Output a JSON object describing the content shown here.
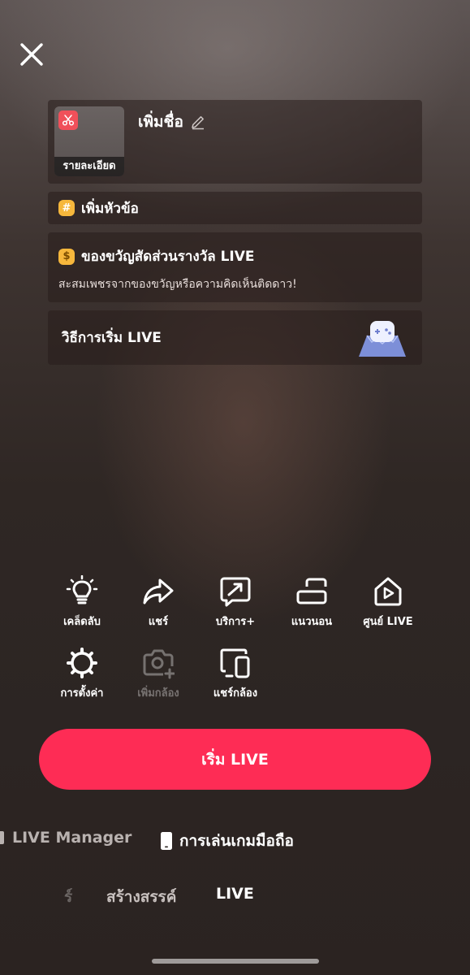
{
  "header": {
    "close_icon": "close-icon"
  },
  "cover": {
    "detail_label": "รายละเอียด",
    "badge_icon": "scissors-icon"
  },
  "title_card": {
    "title": "เพิ่มชื่อ",
    "edit_icon": "pencil-icon"
  },
  "topic_card": {
    "label": "เพิ่มหัวข้อ",
    "icon": "hashtag-icon"
  },
  "gift_card": {
    "title": "ของขวัญสัดส่วนรางวัล LIVE",
    "subtitle": "สะสมเพชรจากของขวัญหรือความคิดเห็นติดดาว!",
    "icon": "coin-icon"
  },
  "howto_card": {
    "label": "วิธีการเริ่ม LIVE",
    "icon": "game-controller-icon"
  },
  "tools": [
    {
      "label": "เคล็ดลับ",
      "icon": "lightbulb-icon"
    },
    {
      "label": "แชร์",
      "icon": "share-icon"
    },
    {
      "label": "บริการ+",
      "icon": "service-icon"
    },
    {
      "label": "แนวนอน",
      "icon": "landscape-icon"
    },
    {
      "label": "ศูนย์ LIVE",
      "icon": "live-center-icon"
    },
    {
      "label": "การตั้งค่า",
      "icon": "gear-icon"
    },
    {
      "label": "เพิ่มกล้อง",
      "icon": "add-camera-icon",
      "disabled": true
    },
    {
      "label": "แชร์กล้อง",
      "icon": "share-camera-icon"
    }
  ],
  "start_button": {
    "label": "เริ่ม LIVE",
    "color": "#fe2c55"
  },
  "modes": [
    {
      "label": "LIVE Manager",
      "icon": "live-manager-icon",
      "active": false
    },
    {
      "label": "การเล่นเกมมือถือ",
      "icon": "mobile-phone-icon",
      "active": true
    }
  ],
  "tabs": [
    {
      "label": "ร์",
      "active": false
    },
    {
      "label": "สร้างสรรค์",
      "active": false
    },
    {
      "label": "LIVE",
      "active": true
    }
  ]
}
